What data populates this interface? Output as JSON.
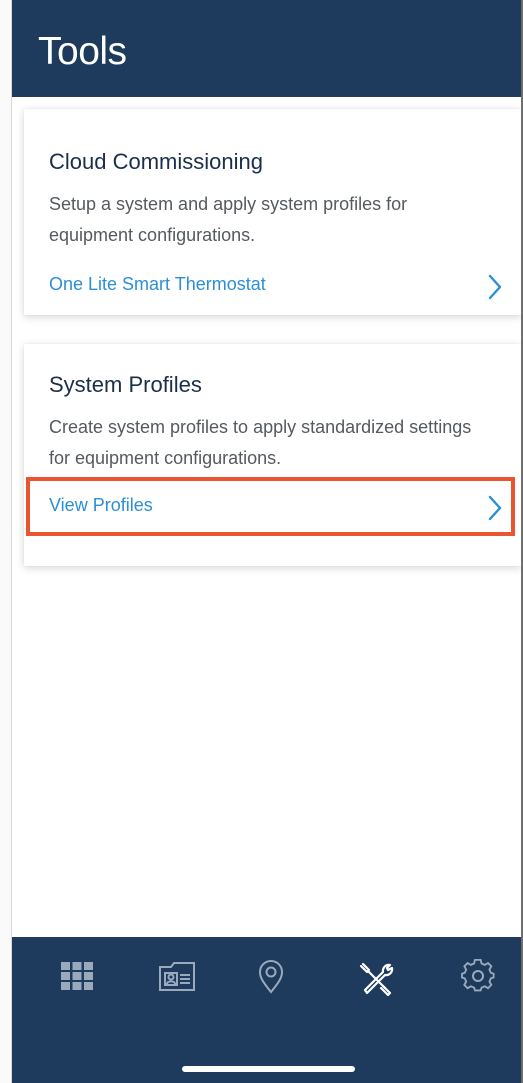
{
  "header": {
    "title": "Tools"
  },
  "cards": [
    {
      "title": "Cloud Commissioning",
      "description": "Setup a system and apply system profiles for equipment configurations.",
      "link_label": "One Lite Smart Thermostat"
    },
    {
      "title": "System Profiles",
      "description": "Create system profiles to apply standardized settings for equipment configurations.",
      "link_label": "View Profiles"
    }
  ],
  "tabbar": {
    "items": [
      {
        "icon": "grid-icon",
        "active": false
      },
      {
        "icon": "id-card-icon",
        "active": false
      },
      {
        "icon": "location-pin-icon",
        "active": false
      },
      {
        "icon": "tools-icon",
        "active": true
      },
      {
        "icon": "gear-icon",
        "active": false
      }
    ]
  },
  "colors": {
    "header_bg": "#1e3a5c",
    "link": "#2b8fd6",
    "highlight": "#e8552f",
    "tab_icon_inactive": "#9aa9bb",
    "tab_icon_active": "#ffffff"
  }
}
